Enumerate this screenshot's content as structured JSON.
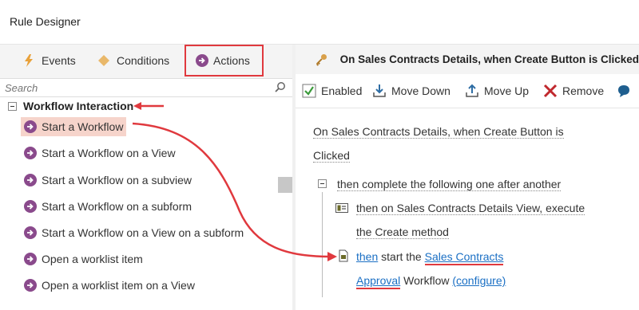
{
  "window": {
    "title": "Rule Designer"
  },
  "tabs": [
    {
      "label": "Events",
      "icon": "lightning-icon"
    },
    {
      "label": "Conditions",
      "icon": "diamond-icon"
    },
    {
      "label": "Actions",
      "icon": "arrow-circle-icon",
      "active": true
    }
  ],
  "search": {
    "placeholder": "Search"
  },
  "tree": {
    "group_label": "Workflow Interaction",
    "items": [
      {
        "label": "Start a Workflow",
        "selected": true
      },
      {
        "label": "Start a Workflow on a View"
      },
      {
        "label": "Start a Workflow on a subview"
      },
      {
        "label": "Start a Workflow on a subform"
      },
      {
        "label": "Start a Workflow on a View on a subform"
      },
      {
        "label": "Open a worklist item"
      },
      {
        "label": "Open a worklist item on a View"
      }
    ]
  },
  "rule_header": {
    "title": "On Sales Contracts Details, when Create Button is Clicked"
  },
  "toolbar": {
    "enabled_label": "Enabled",
    "move_down_label": "Move Down",
    "move_up_label": "Move Up",
    "remove_label": "Remove"
  },
  "rule": {
    "event_line1": "On Sales Contracts Details, when Create Button is",
    "event_line2": "Clicked",
    "sequence": "then complete the following one after another",
    "action1_line1": "then on Sales Contracts Details View, execute",
    "action1_line2": "the Create method",
    "action2_then": "then",
    "action2_mid": " start the ",
    "action2_wf1": "Sales Contracts",
    "action2_wf2": "Approval",
    "action2_workflow": " Workflow ",
    "action2_configure": "(configure)"
  },
  "colors": {
    "highlight_red": "#e0393e",
    "action_purple": "#8a4a8c",
    "link_blue": "#1a6fc4",
    "selected_bg": "#f6d4cb"
  }
}
